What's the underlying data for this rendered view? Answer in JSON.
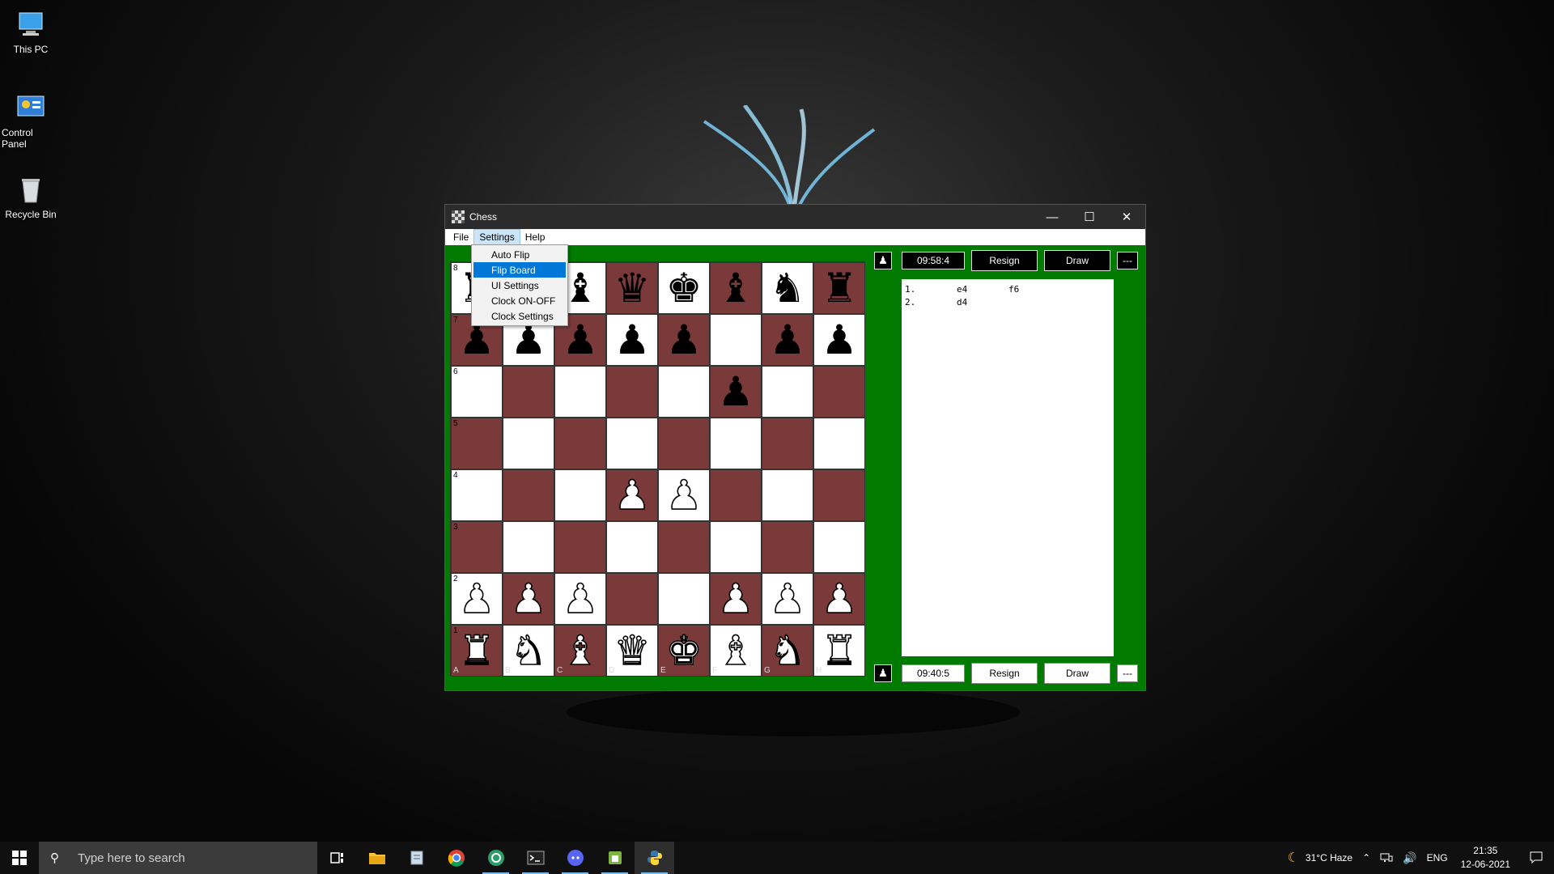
{
  "desktop": {
    "icons": [
      {
        "label": "This PC",
        "icon": "this-pc-icon"
      },
      {
        "label": "Control Panel",
        "icon": "control-panel-icon"
      },
      {
        "label": "Recycle Bin",
        "icon": "recycle-bin-icon"
      }
    ]
  },
  "window": {
    "title": "Chess",
    "minimize": "—",
    "maximize": "☐",
    "close": "✕"
  },
  "menu": {
    "file": "File",
    "settings": "Settings",
    "help": "Help"
  },
  "settings_menu": {
    "items": [
      "Auto Flip",
      "Flip Board",
      "UI Settings",
      "Clock ON-OFF",
      "Clock Settings"
    ],
    "highlighted": "Flip Board"
  },
  "board": {
    "files": [
      "A",
      "B",
      "C",
      "D",
      "E",
      "F",
      "G",
      "H"
    ],
    "ranks": [
      "8",
      "7",
      "6",
      "5",
      "4",
      "3",
      "2",
      "1"
    ],
    "pieces": [
      [
        "♜",
        "♞",
        "♝",
        "♛",
        "♚",
        "♝",
        "♞",
        "♜"
      ],
      [
        "♟",
        "♟",
        "♟",
        "♟",
        "♟",
        "",
        "♟",
        "♟"
      ],
      [
        "",
        "",
        "",
        "",
        "",
        "♟",
        "",
        ""
      ],
      [
        "",
        "",
        "",
        "",
        "",
        "",
        "",
        ""
      ],
      [
        "",
        "",
        "",
        "♟",
        "♟",
        "",
        "",
        ""
      ],
      [
        "",
        "",
        "",
        "",
        "",
        "",
        "",
        ""
      ],
      [
        "♟",
        "♟",
        "♟",
        "",
        "",
        "♟",
        "♟",
        "♟"
      ],
      [
        "♜",
        "♞",
        "♝",
        "♛",
        "♚",
        "♝",
        "♞",
        "♜"
      ]
    ],
    "colors": [
      [
        "b",
        "b",
        "b",
        "b",
        "b",
        "b",
        "b",
        "b"
      ],
      [
        "b",
        "b",
        "b",
        "b",
        "b",
        "",
        "b",
        "b"
      ],
      [
        "",
        "",
        "",
        "",
        "",
        "b",
        "",
        ""
      ],
      [
        "",
        "",
        "",
        "",
        "",
        "",
        "",
        ""
      ],
      [
        "",
        "",
        "",
        "w",
        "w",
        "",
        "",
        ""
      ],
      [
        "",
        "",
        "",
        "",
        "",
        "",
        "",
        ""
      ],
      [
        "w",
        "w",
        "w",
        "",
        "",
        "w",
        "w",
        "w"
      ],
      [
        "w",
        "w",
        "w",
        "w",
        "w",
        "w",
        "w",
        "w"
      ]
    ],
    "dark_color": "#7a3a3a",
    "light_color": "#ffffff"
  },
  "players": {
    "top": {
      "clock": "09:58:4",
      "resign": "Resign",
      "draw": "Draw",
      "more": "---",
      "icon": "person-icon"
    },
    "bottom": {
      "clock": "09:40:5",
      "resign": "Resign",
      "draw": "Draw",
      "more": "---",
      "icon": "person-icon"
    }
  },
  "moves": [
    {
      "num": "1.",
      "white": "e4",
      "black": "f6"
    },
    {
      "num": "2.",
      "white": "d4",
      "black": ""
    }
  ],
  "taskbar": {
    "search_placeholder": "Type here to search",
    "weather": "31°C  Haze",
    "language": "ENG",
    "time": "21:35",
    "date": "12-06-2021",
    "apps": [
      "task-view-icon",
      "file-explorer-icon",
      "notepad-icon",
      "chrome-icon",
      "app-icon",
      "terminal-icon",
      "discord-icon",
      "android-icon",
      "python-icon"
    ]
  },
  "colors": {
    "window_bg": "#007a00",
    "titlebar": "#2b2b2b",
    "menu_highlight": "#0078d7"
  }
}
